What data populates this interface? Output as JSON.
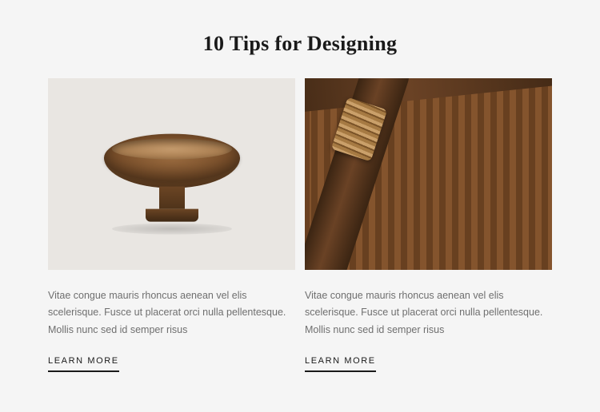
{
  "heading": "10 Tips for Designing",
  "cards": [
    {
      "description": "Vitae congue mauris rhoncus aenean vel elis scelerisque. Fusce ut placerat orci nulla pellentesque. Mollis nunc sed id semper risus",
      "cta": "LEARN MORE"
    },
    {
      "description": "Vitae congue mauris rhoncus aenean vel elis scelerisque. Fusce ut placerat orci nulla pellentesque. Mollis nunc sed id semper risus",
      "cta": "LEARN MORE"
    }
  ]
}
